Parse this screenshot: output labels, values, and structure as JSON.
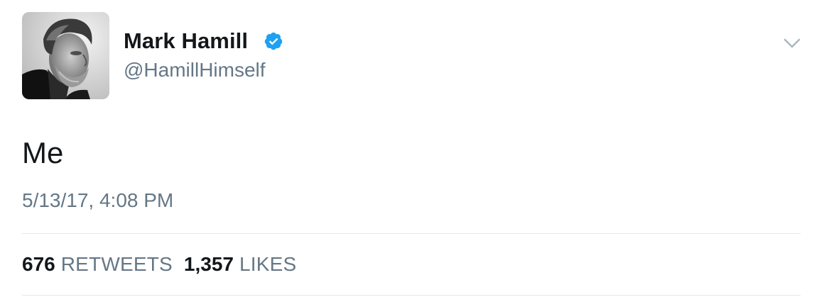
{
  "author": {
    "display_name": "Mark Hamill",
    "handle": "@HamillHimself",
    "verified": true,
    "verified_color": "#1da1f2"
  },
  "icons": {
    "verified": "verified-badge-icon",
    "menu": "chevron-down-icon"
  },
  "tweet": {
    "text": "Me",
    "timestamp": "5/13/17, 4:08 PM"
  },
  "stats": {
    "retweets_count": "676",
    "retweets_label": "RETWEETS",
    "likes_count": "1,357",
    "likes_label": "LIKES"
  },
  "colors": {
    "text_primary": "#14171a",
    "text_secondary": "#657786",
    "divider": "#e1e8ed"
  }
}
